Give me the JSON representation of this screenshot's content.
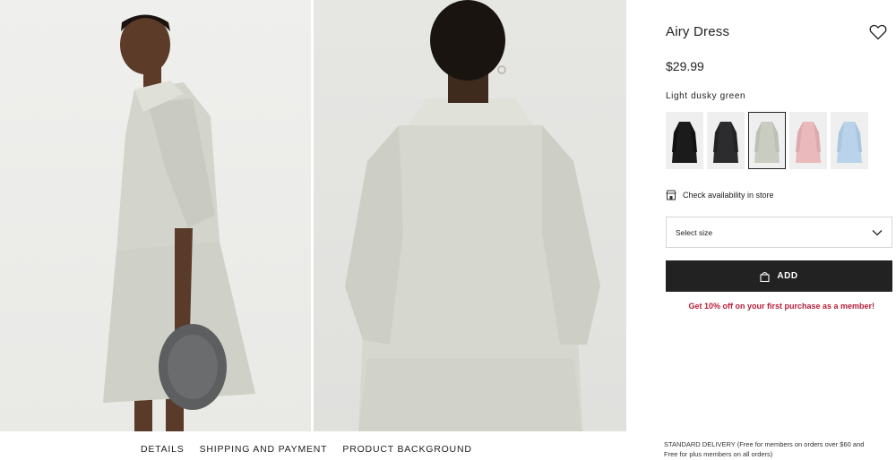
{
  "product": {
    "title": "Airy Dress",
    "price": "$29.99",
    "color_name": "Light dusky green",
    "swatches": [
      {
        "name": "black",
        "color": "#1b1b1b",
        "selected": false
      },
      {
        "name": "dark grey",
        "color": "#2c2c2e",
        "selected": false
      },
      {
        "name": "light dusky green",
        "color": "#c9ccc1",
        "selected": true
      },
      {
        "name": "light pink",
        "color": "#e9b9bb",
        "selected": false
      },
      {
        "name": "light blue",
        "color": "#b9d3ea",
        "selected": false
      }
    ],
    "favorite_icon": "heart-icon"
  },
  "store": {
    "label": "Check availability in store",
    "icon": "store-icon"
  },
  "size_select": {
    "placeholder": "Select size",
    "icon": "chevron-down-icon"
  },
  "add_button": {
    "label": "ADD",
    "icon": "bag-icon"
  },
  "promo": {
    "text": "Get 10% off on your first purchase as a member!",
    "color": "#b5203c"
  },
  "tabs": [
    "DETAILS",
    "SHIPPING AND PAYMENT",
    "PRODUCT BACKGROUND"
  ],
  "delivery": {
    "line1": "STANDARD DELIVERY (Free for members on orders over $60 and",
    "line2": "Free for plus members on all orders)"
  },
  "colors": {
    "accent_dark": "#222222",
    "promo_red": "#b5203c",
    "dress": "#d2d4cb"
  }
}
